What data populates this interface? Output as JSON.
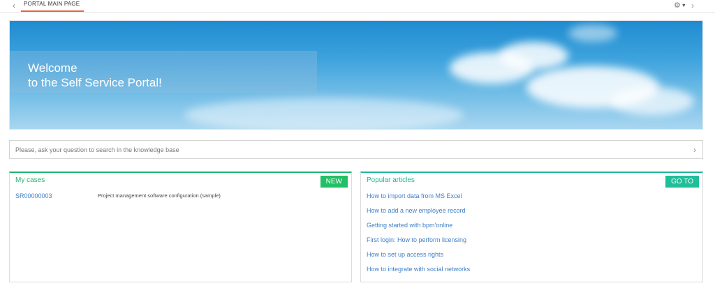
{
  "topbar": {
    "back_icon": "chevron-left-icon",
    "tab_label": "PORTAL MAIN PAGE",
    "settings_icon": "gear-icon",
    "forward_icon": "chevron-right-icon",
    "accent_color": "#e8623d"
  },
  "banner": {
    "line1": "Welcome",
    "line2": "to the Self Service Portal!"
  },
  "search": {
    "placeholder": "Please, ask your question to search in the knowledge base"
  },
  "cases": {
    "title": "My cases",
    "action_label": "NEW",
    "rows": [
      {
        "id": "SR00000003",
        "description": "Project management software configuration (sample)"
      }
    ],
    "accent_color": "#22b36f"
  },
  "articles": {
    "title": "Popular articles",
    "action_label": "GO TO",
    "items": [
      "How to import data from MS Excel",
      "How to add a new employee record",
      "Getting started with bpm'online",
      "First login: How to perform licensing",
      "How to set up access rights",
      "How to integrate with social networks"
    ],
    "accent_color": "#1fb69c"
  }
}
